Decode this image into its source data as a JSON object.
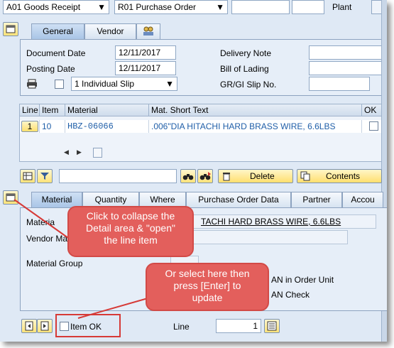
{
  "header": {
    "transaction": "A01 Goods Receipt",
    "reference": "R01 Purchase Order",
    "plant_label": "Plant"
  },
  "header_tabs": [
    {
      "label": "General"
    },
    {
      "label": "Vendor"
    }
  ],
  "general": {
    "document_date_label": "Document Date",
    "document_date": "12/11/2017",
    "posting_date_label": "Posting Date",
    "posting_date": "12/11/2017",
    "print_option": "1 Individual Slip",
    "delivery_note_label": "Delivery Note",
    "bill_of_lading_label": "Bill of Lading",
    "gr_slip_label": "GR/GI Slip No."
  },
  "items_table": {
    "columns": [
      "Line",
      "Item",
      "Material",
      "Mat. Short Text",
      "OK"
    ],
    "rows": [
      {
        "line": "1",
        "item": "10",
        "material": "HBZ-06066",
        "short_text": ".006\"DIA HITACHI HARD BRASS WIRE, 6.6LBS"
      }
    ]
  },
  "toolbar": {
    "delete_label": "Delete",
    "contents_label": "Contents"
  },
  "detail_tabs": [
    {
      "label": "Material"
    },
    {
      "label": "Quantity"
    },
    {
      "label": "Where"
    },
    {
      "label": "Purchase Order Data"
    },
    {
      "label": "Partner"
    },
    {
      "label": "Accou"
    }
  ],
  "detail": {
    "material_label": "Materia",
    "material_text": "TACHI HARD BRASS WIRE, 6.6LBS",
    "vendor_label": "Vendor Ma",
    "material_group_label": "Material Group",
    "ean_order_unit_label": "AN in Order Unit",
    "ean_check_label": "AN Check",
    "item_ok_label": "Item OK",
    "line_label": "Line",
    "line_value": "1"
  },
  "callouts": {
    "collapse": [
      "Click to collapse the",
      "Detail area & \"open\"",
      "the line item"
    ],
    "select": [
      "Or select here then",
      "press [Enter] to",
      "update"
    ]
  },
  "colors": {
    "frame_bg": "#dfe9f5",
    "callout_red": "#e35f5c",
    "link_blue": "#1f5ea8"
  }
}
